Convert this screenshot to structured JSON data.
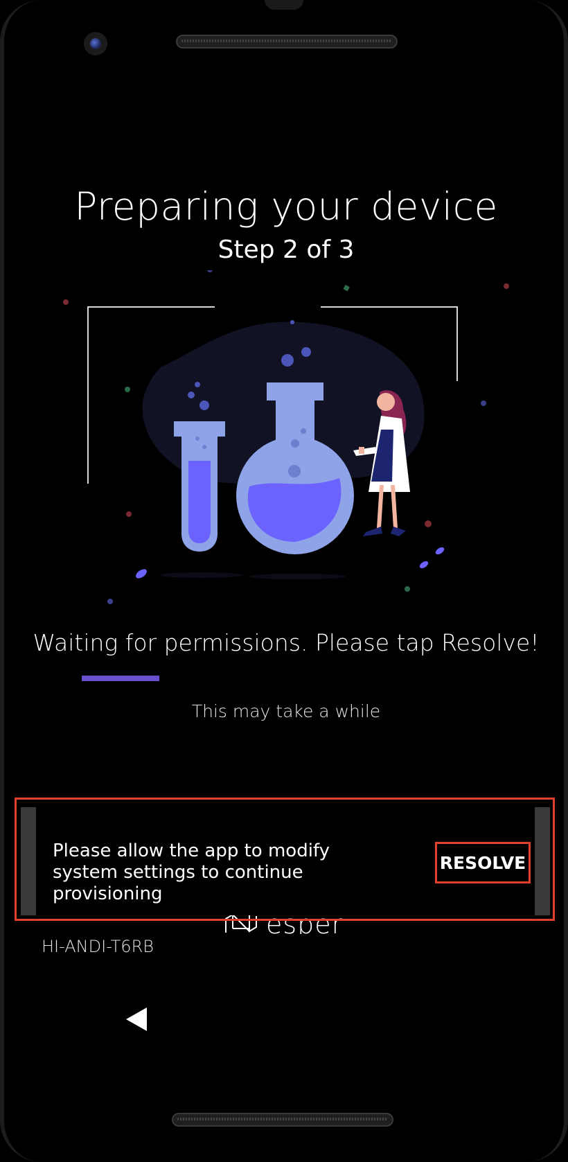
{
  "screen": {
    "title": "Preparing your device",
    "step": "Step 2 of 3",
    "status": "Waiting for permissions. Please tap Resolve!",
    "progress_fraction": 0.19,
    "hint": "This may take a while",
    "illustration_icon": "scientist-lab-flasks-illustration"
  },
  "snackbar": {
    "message": "Please allow the app to modify system settings to continue provisioning",
    "action_label": "RESOLVE",
    "highlight_color": "#e0412a"
  },
  "brand": {
    "name": "esper",
    "logo_icon": "esper-logo-icon"
  },
  "device": {
    "id": "HI-ANDI-T6RB"
  },
  "navigation": {
    "back_icon": "back-triangle-icon"
  },
  "colors": {
    "background": "#000000",
    "accent": "#6a4fd0",
    "flask": "#8fa3e8",
    "liquid": "#6c63ff"
  }
}
